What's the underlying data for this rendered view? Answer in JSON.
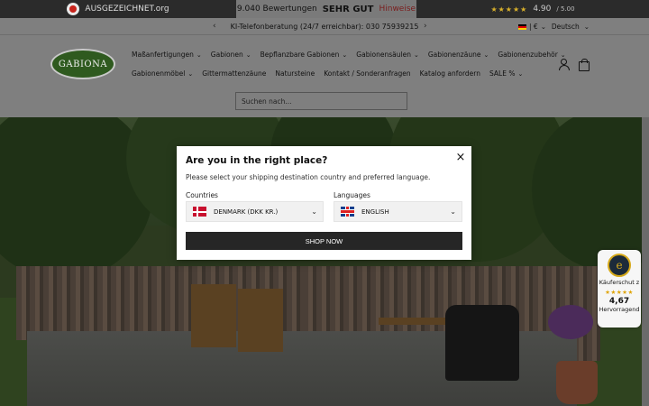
{
  "topbar": {
    "award_text": "AUSGEZEICHNET.org",
    "reviews_count": "9.040 Bewertungen",
    "rating_word": "SEHR GUT",
    "hint_link": "Hinweise",
    "stars": "★★★★★",
    "score": "4.90",
    "score_max": "/ 5.00"
  },
  "header": {
    "announcement": "KI-Telefonberatung (24/7 erreichbar): 030 75939215",
    "prev_arrow": "‹",
    "next_arrow": "›",
    "currency": "| €",
    "language": "Deutsch",
    "logo_text": "GABIONA",
    "search_placeholder": "Suchen nach...",
    "nav_row1": [
      "Maßanfertigungen",
      "Gabionen",
      "Bepflanzbare Gabionen",
      "Gabionensäulen",
      "Gabionenzäune",
      "Gabionenzubehör"
    ],
    "nav_row2": [
      "Gabionenmöbel",
      "Gittermattenzäune",
      "Natursteine",
      "Kontakt / Sonderanfragen",
      "Katalog anfordern",
      "SALE %"
    ]
  },
  "trust_badge": {
    "seal_letter": "e",
    "label": "Käuferschut z",
    "stars": "★★★★★",
    "score": "4,67",
    "rating_word": "Hervorragend"
  },
  "modal": {
    "title": "Are you in the right place?",
    "description": "Please select your shipping destination country and preferred language.",
    "countries_label": "Countries",
    "country_value": "DENMARK (DKK KR.)",
    "languages_label": "Languages",
    "language_value": "ENGLISH",
    "button": "SHOP NOW",
    "close": "×"
  }
}
